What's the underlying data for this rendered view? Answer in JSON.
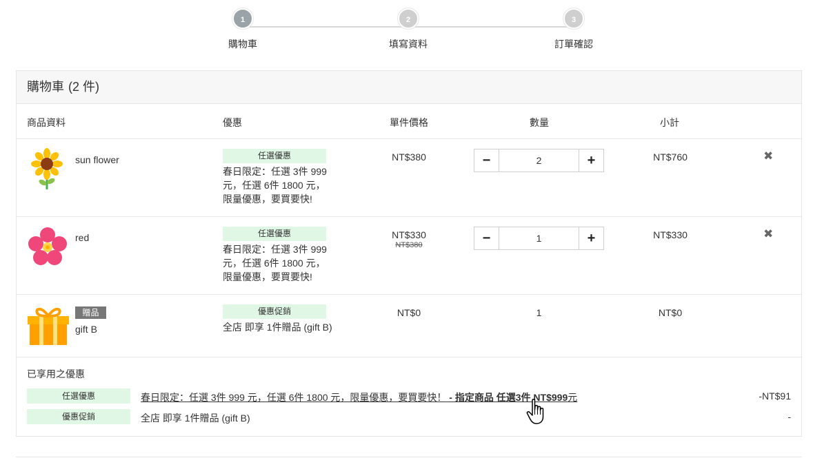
{
  "stepper": {
    "steps": [
      {
        "number": "1",
        "label": "購物車"
      },
      {
        "number": "2",
        "label": "填寫資料"
      },
      {
        "number": "3",
        "label": "訂單確認"
      }
    ]
  },
  "cart": {
    "title": "購物車",
    "count": "(2 件)",
    "headers": {
      "product": "商品資料",
      "promo": "優惠",
      "unit_price": "單件價格",
      "quantity": "數量",
      "subtotal": "小計"
    },
    "items": [
      {
        "name": "sun flower",
        "image": "sunflower-icon",
        "promo_tag": "任選優惠",
        "promo_desc": "春日限定：任選 3件 999 元，任選 6件 1800 元，限量優惠，要買要快!",
        "price": "NT$380",
        "quantity": "2",
        "subtotal": "NT$760",
        "remove": "✖"
      },
      {
        "name": "red",
        "image": "red-flower-icon",
        "promo_tag": "任選優惠",
        "promo_desc": "春日限定：任選 3件 999 元，任選 6件 1800 元，限量優惠，要買要快!",
        "price": "NT$330",
        "old_price": "NT$380",
        "quantity": "1",
        "subtotal": "NT$330",
        "remove": "✖"
      },
      {
        "name": "gift B",
        "badge": "贈品",
        "image": "gift-icon",
        "promo_tag": "優惠促銷",
        "promo_desc": "全店 即享 1件贈品 (gift B)",
        "price": "NT$0",
        "quantity": "1",
        "subtotal": "NT$0"
      }
    ],
    "qty_minus": "−",
    "qty_plus": "+",
    "applied": {
      "title": "已享用之優惠",
      "rows": [
        {
          "tag": "任選優惠",
          "desc": "春日限定：任選 3件 999 元，任選 6件 1800 元，限量優惠，要買要快！",
          "desc_bold": " - 指定商品 任選3件 NT$999",
          "desc_tail": "元",
          "amount": "-NT$91"
        },
        {
          "tag": "優惠促銷",
          "desc": "全店 即享 1件贈品 (gift B)",
          "amount": "-"
        }
      ]
    }
  },
  "colors": {
    "promo_tag_bg": "#e1f7e6",
    "step_active": "#9aa3a8",
    "step_inactive": "#cfcfcf",
    "gift_badge_bg": "#777777"
  }
}
